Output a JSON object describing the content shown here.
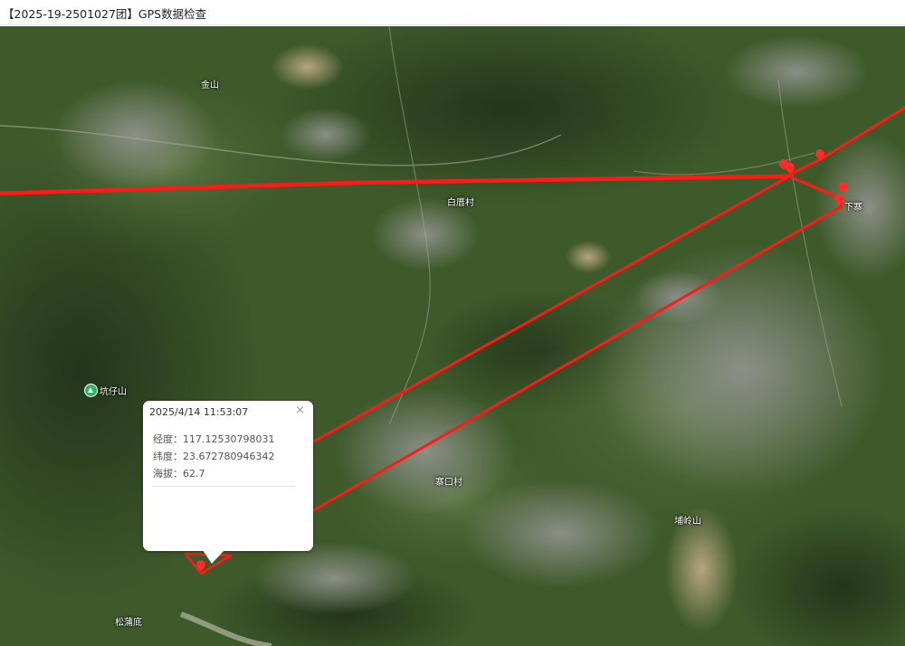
{
  "window": {
    "title": "【2025-19-2501027团】GPS数据检查"
  },
  "map": {
    "place_labels": {
      "jinshan": "金山",
      "baicuo": "白厝村",
      "xiazhai": "下寨",
      "zhaikou": "寨口村",
      "pulingshan": "埔岭山",
      "songpudi": "松蒲底"
    },
    "poi": {
      "kengzaishan": "坑仔山"
    },
    "track_color": "#ff1a1a",
    "marker_color": "#ff2a2a"
  },
  "popup": {
    "time": "2025/4/14 11:53:07",
    "close_label": "×",
    "longitude_label": "经度：",
    "longitude_value": "117.12530798031",
    "latitude_label": "纬度：",
    "latitude_value": "23.672780946342",
    "altitude_label": "海拔：",
    "altitude_value": "62.7"
  }
}
